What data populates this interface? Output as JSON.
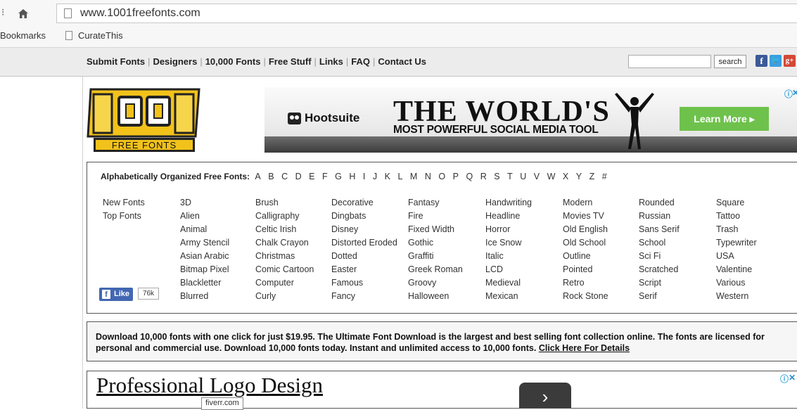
{
  "browser": {
    "url": "www.1001freefonts.com",
    "bookmarks_label": "Bookmarks",
    "bookmark_item": "CurateThis"
  },
  "nav": {
    "links": [
      "Submit Fonts",
      "Designers",
      "10,000 Fonts",
      "Free Stuff",
      "Links",
      "FAQ",
      "Contact Us"
    ],
    "search_button": "search"
  },
  "logo": {
    "number": "1001",
    "tagline": "FREE FONTS"
  },
  "banner_ad": {
    "brand": "Hootsuite",
    "headline": "THE WORLD'S",
    "subline": "MOST POWERFUL SOCIAL MEDIA TOOL",
    "cta": "Learn More ▸"
  },
  "categories": {
    "alpha_label": "Alphabetically Organized Free Fonts:",
    "letters": [
      "A",
      "B",
      "C",
      "D",
      "E",
      "F",
      "G",
      "H",
      "I",
      "J",
      "K",
      "L",
      "M",
      "N",
      "O",
      "P",
      "Q",
      "R",
      "S",
      "T",
      "U",
      "V",
      "W",
      "X",
      "Y",
      "Z",
      "#"
    ],
    "columns": [
      [
        "New Fonts",
        "Top Fonts"
      ],
      [
        "3D",
        "Alien",
        "Animal",
        "Army Stencil",
        "Asian Arabic",
        "Bitmap Pixel",
        "Blackletter",
        "Blurred"
      ],
      [
        "Brush",
        "Calligraphy",
        "Celtic Irish",
        "Chalk Crayon",
        "Christmas",
        "Comic Cartoon",
        "Computer",
        "Curly"
      ],
      [
        "Decorative",
        "Dingbats",
        "Disney",
        "Distorted Eroded",
        "Dotted",
        "Easter",
        "Famous",
        "Fancy"
      ],
      [
        "Fantasy",
        "Fire",
        "Fixed Width",
        "Gothic",
        "Graffiti",
        "Greek Roman",
        "Groovy",
        "Halloween"
      ],
      [
        "Handwriting",
        "Headline",
        "Horror",
        "Ice Snow",
        "Italic",
        "LCD",
        "Medieval",
        "Mexican"
      ],
      [
        "Modern",
        "Movies TV",
        "Old English",
        "Old School",
        "Outline",
        "Pointed",
        "Retro",
        "Rock Stone"
      ],
      [
        "Rounded",
        "Russian",
        "Sans Serif",
        "School",
        "Sci Fi",
        "Scratched",
        "Script",
        "Serif"
      ],
      [
        "Square",
        "Tattoo",
        "Trash",
        "Typewriter",
        "USA",
        "Valentine",
        "Various",
        "Western"
      ]
    ],
    "like_label": "Like",
    "like_count": "76k"
  },
  "promo": {
    "text": "Download 10,000 fonts with one click for just $19.95. The Ultimate Font Download is the largest and best selling font collection online. The fonts are licensed for personal and commercial use. Download 10,000 fonts today. Instant and unlimited access to 10,000 fonts.",
    "link": "Click Here For Details"
  },
  "lower_ad": {
    "title": "Professional Logo Design",
    "tooltip": "fiverr.com",
    "arrow": "›"
  }
}
